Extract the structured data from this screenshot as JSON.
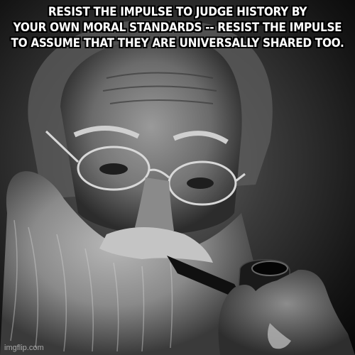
{
  "caption": {
    "line1": "RESIST THE IMPULSE TO JUDGE HISTORY BY",
    "line2": "YOUR OWN MORAL STANDARDS -- RESIST THE IMPULSE",
    "line3": "TO ASSUME THAT THEY ARE UNIVERSALLY SHARED TOO."
  },
  "watermark": "imgflip.com",
  "photo": {
    "subject": "old-man-with-beard-glasses-and-pipe",
    "palette": "black-and-white"
  }
}
